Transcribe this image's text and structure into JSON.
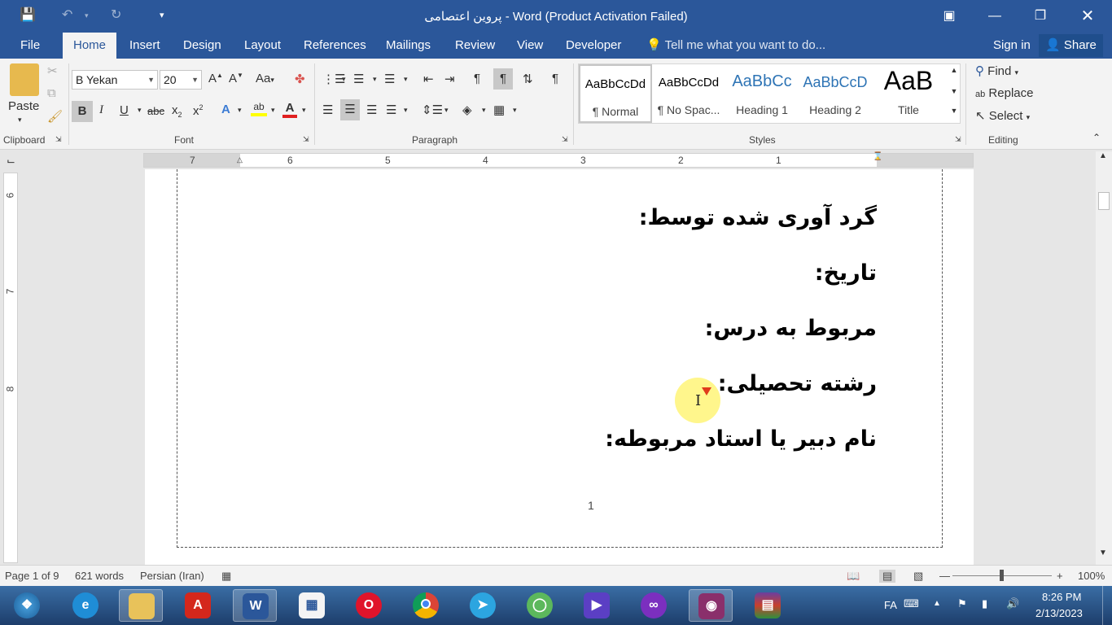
{
  "window": {
    "title": "پروین اعتصامی - Word (Product Activation Failed)"
  },
  "tabs": [
    "File",
    "Home",
    "Insert",
    "Design",
    "Layout",
    "References",
    "Mailings",
    "Review",
    "View",
    "Developer"
  ],
  "tell_me": "Tell me what you want to do...",
  "sign_in": "Sign in",
  "share": "Share",
  "ribbon": {
    "clipboard": {
      "paste": "Paste",
      "label": "Clipboard"
    },
    "font": {
      "family": "B Yekan",
      "size": "20",
      "label": "Font",
      "case_btn": "Aa"
    },
    "paragraph": {
      "label": "Paragraph"
    },
    "styles": {
      "label": "Styles",
      "items": [
        {
          "sample": "AaBbCcDd",
          "name": "¶ Normal"
        },
        {
          "sample": "AaBbCcDd",
          "name": "¶ No Spac..."
        },
        {
          "sample": "AaBbCc",
          "name": "Heading 1"
        },
        {
          "sample": "AaBbCcD",
          "name": "Heading 2"
        },
        {
          "sample": "AaB",
          "name": "Title"
        }
      ]
    },
    "editing": {
      "label": "Editing",
      "find": "Find",
      "replace": "Replace",
      "select": "Select"
    }
  },
  "ruler": {
    "numbers": [
      "7",
      "6",
      "5",
      "4",
      "3",
      "2",
      "1"
    ]
  },
  "vruler": {
    "numbers": [
      "6",
      "7",
      "8"
    ]
  },
  "document": {
    "lines": [
      "گرد آوری شده توسط:",
      "تاریخ:",
      "مربوط به درس:",
      "رشته تحصیلی:",
      "نام دبیر یا استاد مربوطه:"
    ],
    "page_number": "1"
  },
  "status": {
    "page": "Page 1 of 9",
    "words": "621 words",
    "language": "Persian (Iran)",
    "zoom": "100%"
  },
  "taskbar": {
    "lang": "FA",
    "time": "8:26 PM",
    "date": "2/13/2023"
  },
  "colors": {
    "accent": "#2b579a",
    "font_color": "#e02020",
    "highlight": "#ffff00"
  }
}
